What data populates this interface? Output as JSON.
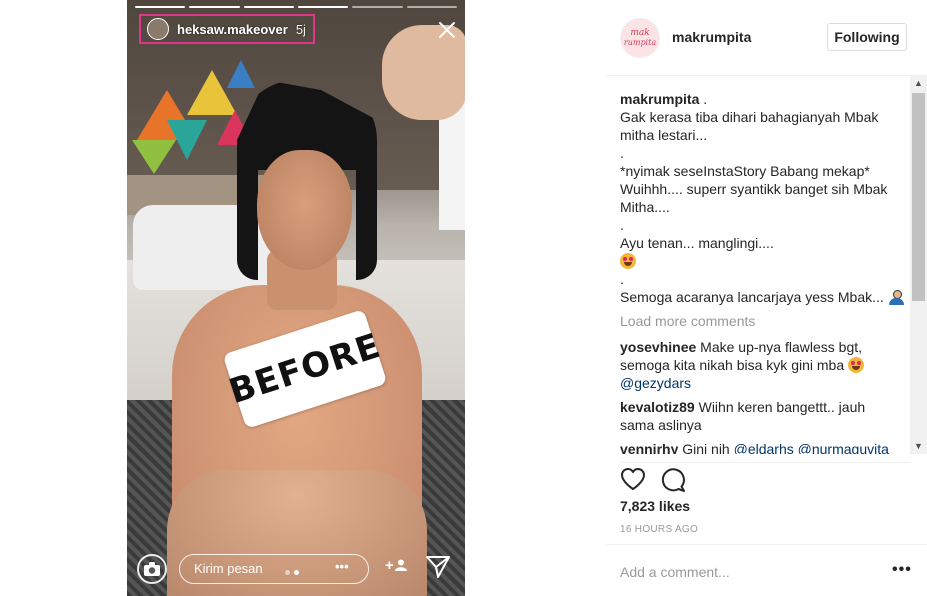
{
  "story": {
    "username": "heksaw.makeover",
    "time": "5j",
    "sticker_text": "BEFORE",
    "message_placeholder": "Kirim pesan",
    "more": "•••",
    "add_person": "+👤"
  },
  "post": {
    "username": "makrumpita",
    "avatar_lines": [
      "mak",
      "rumpita"
    ],
    "follow_label": "Following",
    "caption_user": "makrumpita",
    "caption_lines": [
      ".",
      "Gak kerasa tiba dihari bahagianyah Mbak",
      "mitha lestari...",
      ".",
      "*nyimak seseInstaStory Babang mekap*",
      "Wuihhh.... superr syantikk banget sih Mbak",
      "Mitha....",
      ".",
      "Ayu tenan... manglingi....",
      "",
      ".",
      "Semoga acaranya lancarjaya yess Mbak..."
    ],
    "load_more": "Load more comments",
    "comments": [
      {
        "user": "yosevhinee",
        "text_1": "Make up-nya flawless bgt,",
        "text_2": "semoga kita nikah bisa kyk gini mba",
        "mention": "@gezydars"
      },
      {
        "user": "kevalotiz89",
        "text_1": "Wiihn keren bangettt.. jauh",
        "text_2": "sama aslinya"
      },
      {
        "user": "vennirhy",
        "text_1": "Gini nih",
        "mention_1": "@eldarhs",
        "mention_2": "@nurmaguvita"
      }
    ],
    "likes": "7,823 likes",
    "time_ago": "16 HOURS AGO",
    "add_comment_placeholder": "Add a comment...",
    "options": "•••"
  },
  "colors": {
    "story_highlight_border": "#e0358a",
    "mention": "#003569",
    "muted": "#999999",
    "text": "#262626"
  },
  "icons": [
    "close-icon",
    "camera-icon",
    "send-icon",
    "heart-icon",
    "comment-icon",
    "options-icon"
  ]
}
